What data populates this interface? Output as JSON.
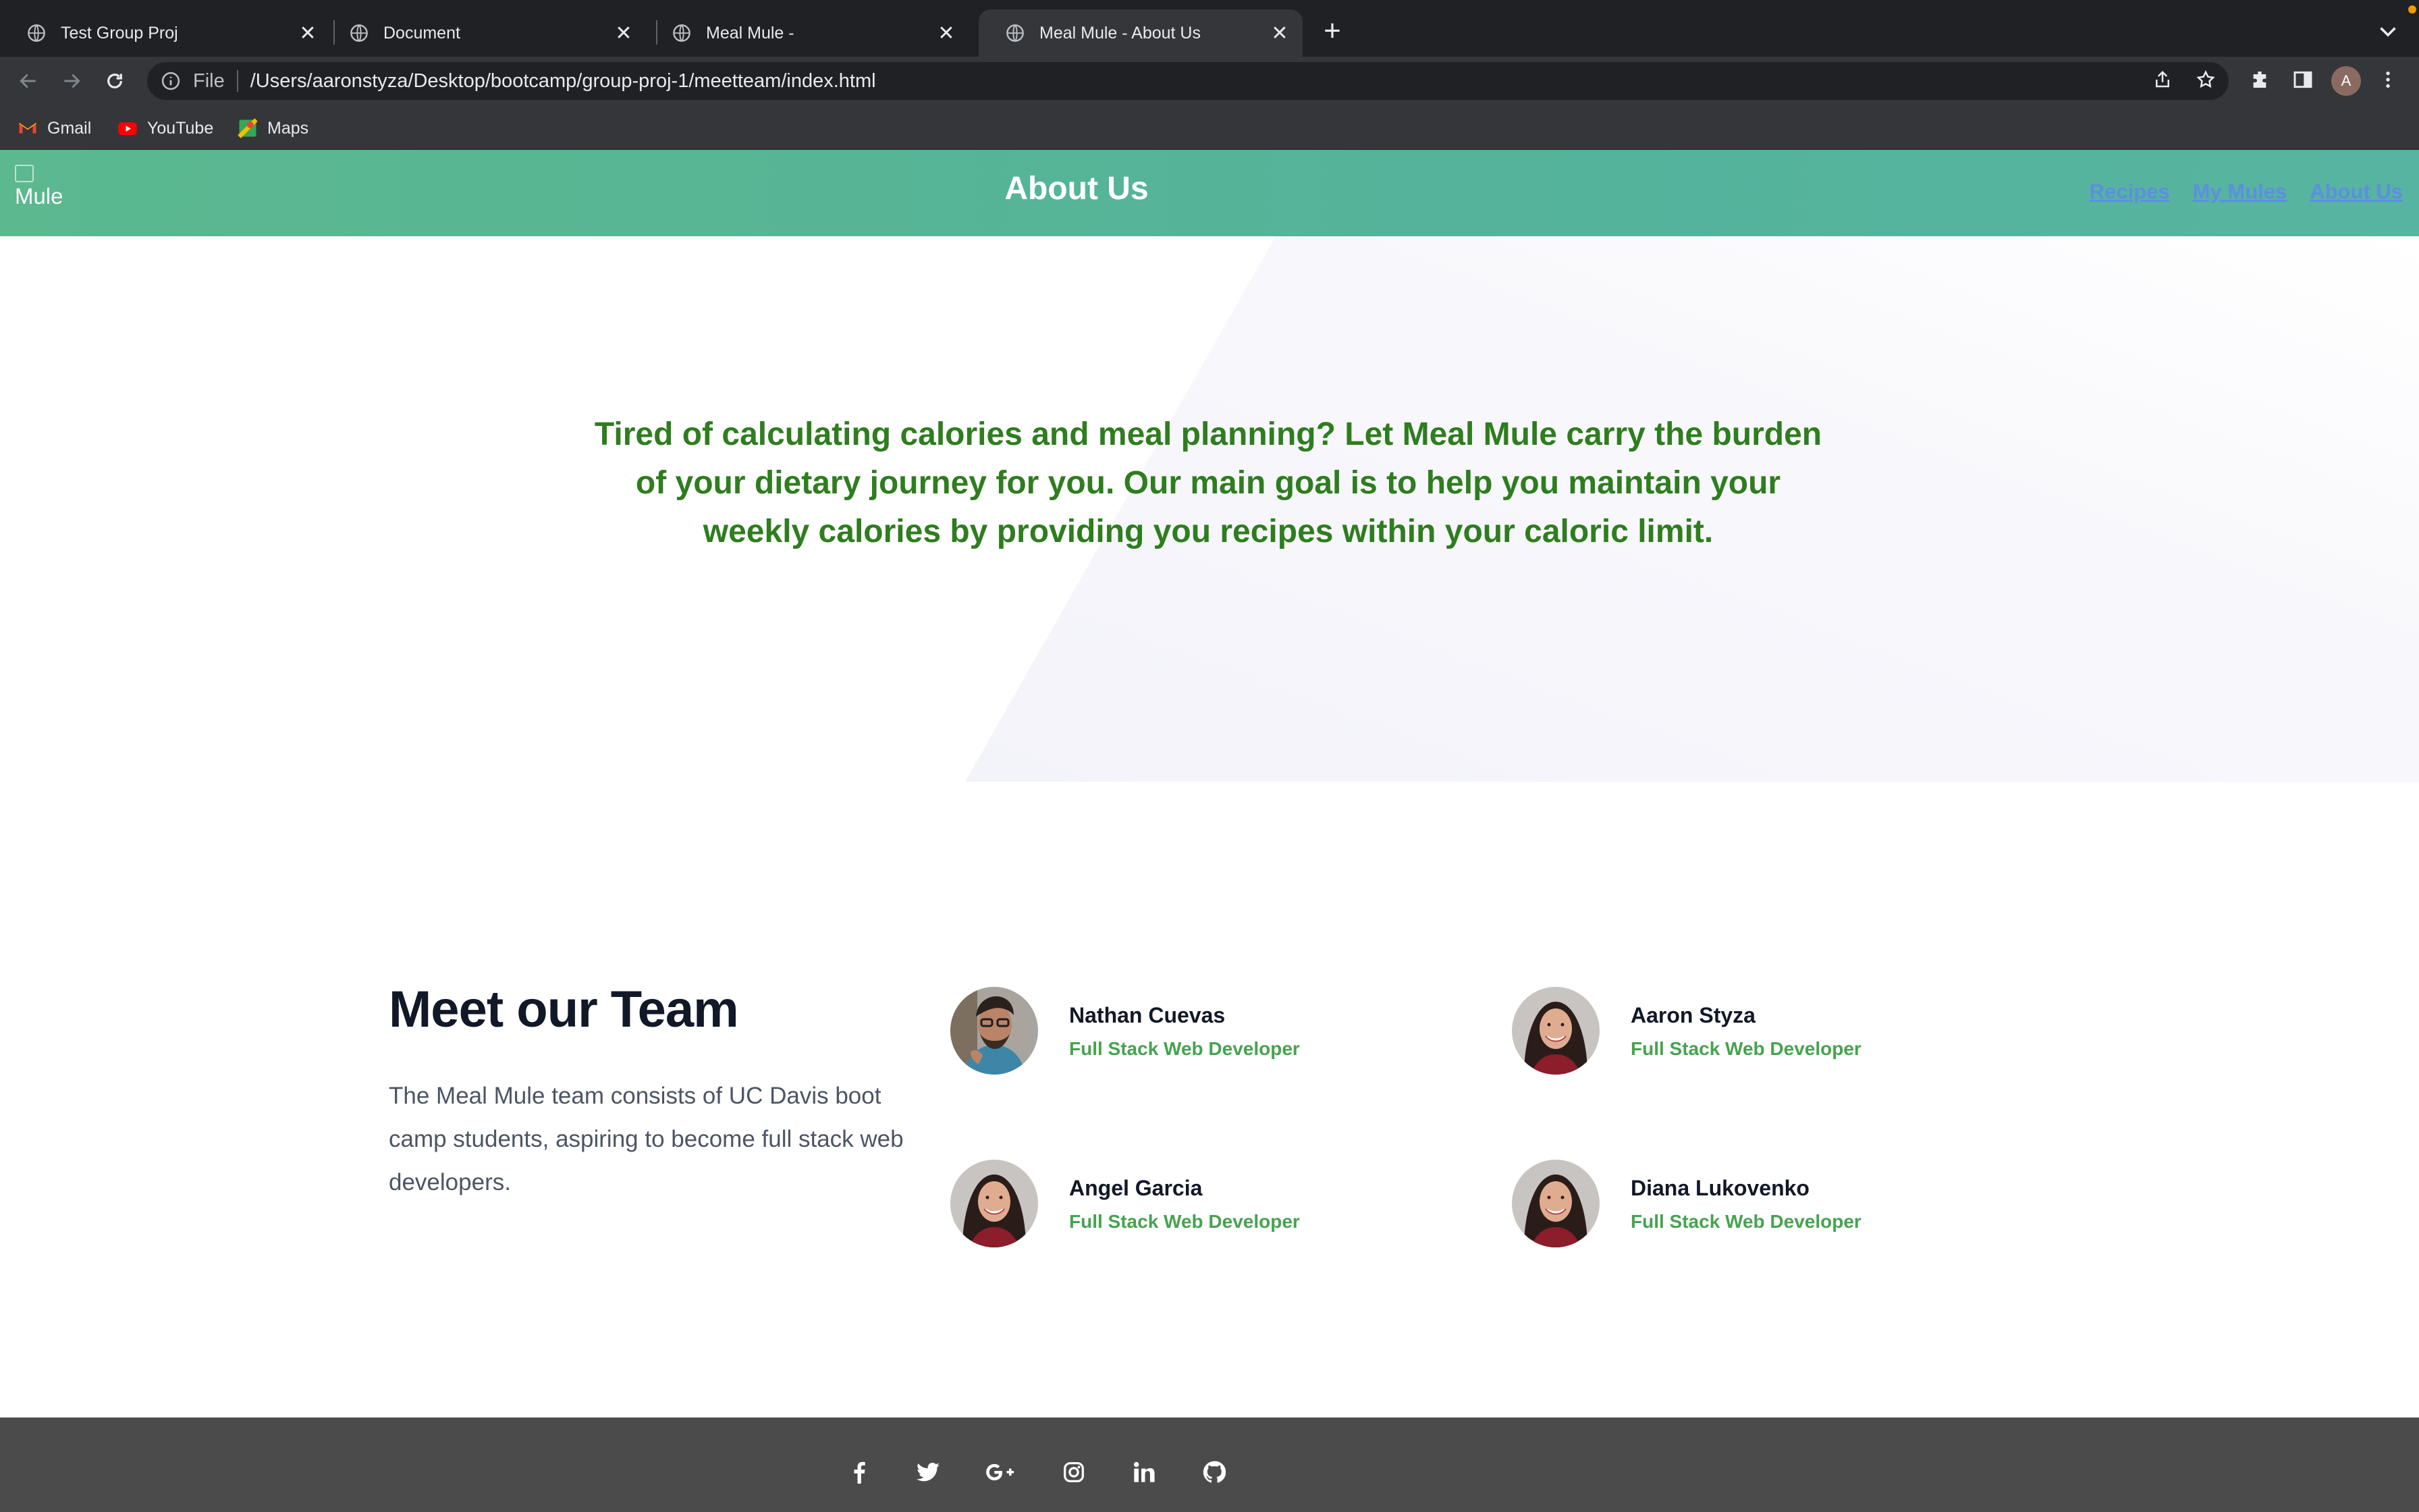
{
  "browser": {
    "tabs": [
      {
        "title": "Test Group Proj",
        "active": false
      },
      {
        "title": "Document",
        "active": false
      },
      {
        "title": "Meal Mule -",
        "active": false
      },
      {
        "title": "Meal Mule - About Us",
        "active": true
      }
    ],
    "new_tab_label": "+",
    "address": {
      "scheme_label": "File",
      "url": "/Users/aaronstyza/Desktop/bootcamp/group-proj-1/meetteam/index.html"
    },
    "profile_initial": "A",
    "bookmarks": [
      {
        "label": "Gmail",
        "icon": "gmail-icon"
      },
      {
        "label": "YouTube",
        "icon": "youtube-icon"
      },
      {
        "label": "Maps",
        "icon": "maps-icon"
      }
    ]
  },
  "header": {
    "logo_alt": "Mule",
    "title": "About Us",
    "nav": [
      "Recipes",
      "My Mules",
      "About Us"
    ],
    "gradient": [
      "#5bb88f",
      "#56b4a0"
    ],
    "link_color": "#5c8fe0"
  },
  "hero": {
    "mission": "Tired of calculating calories and meal planning? Let Meal Mule carry the burden of your dietary journey for you. Our main goal is to help you maintain your weekly calories by providing you recipes within your caloric limit.",
    "text_color": "#2e7d1e"
  },
  "team": {
    "heading": "Meet our Team",
    "description": "The Meal Mule team consists of UC Davis boot camp students, aspiring to become full stack web developers.",
    "members": [
      {
        "name": "Nathan Cuevas",
        "role": "Full Stack Web Developer"
      },
      {
        "name": "Aaron Styza",
        "role": "Full Stack Web Developer"
      },
      {
        "name": "Angel Garcia",
        "role": "Full Stack Web Developer"
      },
      {
        "name": "Diana Lukovenko",
        "role": "Full Stack Web Developer"
      }
    ],
    "role_color": "#46a34f"
  },
  "footer": {
    "social": [
      "facebook-icon",
      "twitter-icon",
      "google-plus-icon",
      "instagram-icon",
      "linkedin-icon",
      "github-icon"
    ],
    "background": "#4b4b4b"
  }
}
